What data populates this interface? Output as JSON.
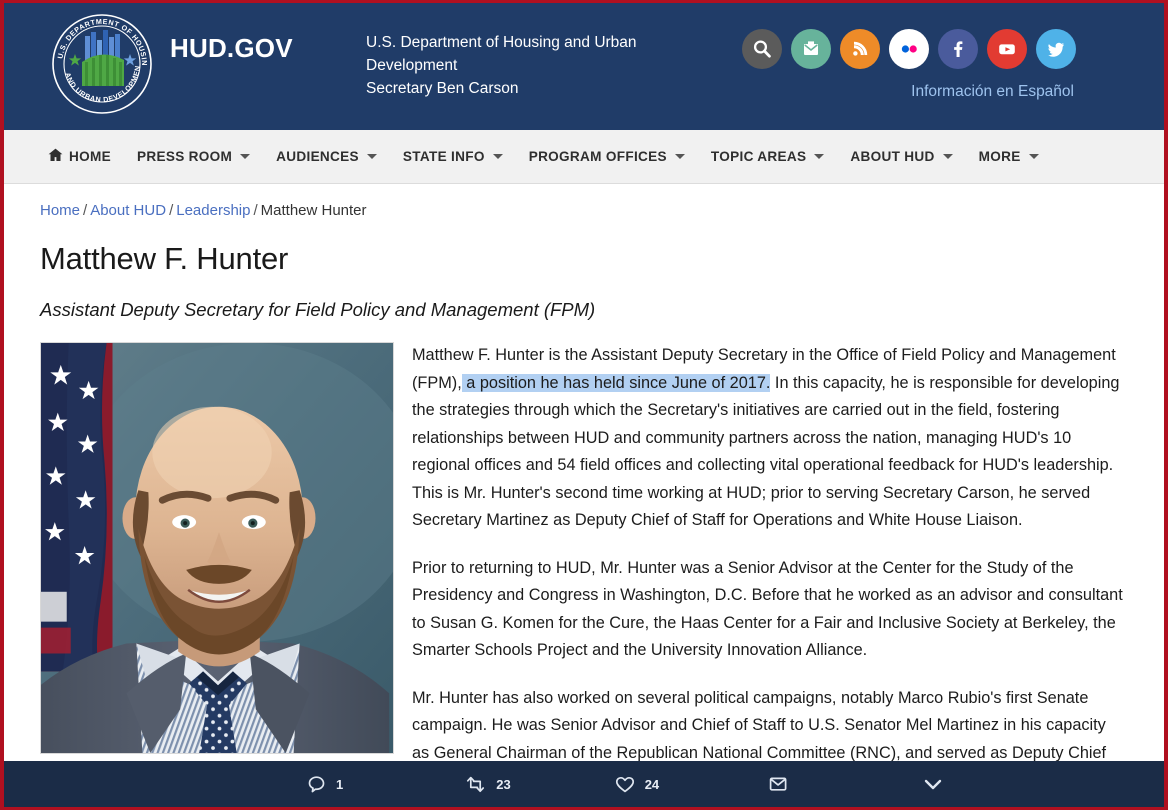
{
  "header": {
    "wordmark": "HUD.GOV",
    "seal_text": "U.S. DEPARTMENT OF HOUSING AND URBAN DEVELOPMENT",
    "department_line1": "U.S. Department of Housing and Urban Development",
    "department_line2": "Secretary Ben Carson",
    "espanol_label": "Información en Español",
    "background_color": "#203c68",
    "social": [
      {
        "name": "search-icon",
        "label": "Search",
        "color": "#5b5b5b"
      },
      {
        "name": "email-icon",
        "label": "Email",
        "color": "#67b39b"
      },
      {
        "name": "rss-icon",
        "label": "RSS",
        "color": "#ee8b28"
      },
      {
        "name": "flickr-icon",
        "label": "Flickr",
        "color": "#ffffff"
      },
      {
        "name": "facebook-icon",
        "label": "Facebook",
        "color": "#4a5b9c"
      },
      {
        "name": "youtube-icon",
        "label": "YouTube",
        "color": "#e23b32"
      },
      {
        "name": "twitter-icon",
        "label": "Twitter",
        "color": "#4fb2e8"
      }
    ]
  },
  "nav": {
    "items": [
      {
        "label": "HOME",
        "icon": "home-icon",
        "has_dropdown": false
      },
      {
        "label": "PRESS ROOM",
        "icon": "",
        "has_dropdown": true
      },
      {
        "label": "AUDIENCES",
        "icon": "",
        "has_dropdown": true
      },
      {
        "label": "STATE INFO",
        "icon": "",
        "has_dropdown": true
      },
      {
        "label": "PROGRAM OFFICES",
        "icon": "",
        "has_dropdown": true
      },
      {
        "label": "TOPIC AREAS",
        "icon": "",
        "has_dropdown": true
      },
      {
        "label": "ABOUT HUD",
        "icon": "",
        "has_dropdown": true
      },
      {
        "label": "MORE",
        "icon": "",
        "has_dropdown": true
      }
    ]
  },
  "breadcrumb": {
    "items": [
      {
        "label": "Home",
        "is_link": true
      },
      {
        "label": "About HUD",
        "is_link": true
      },
      {
        "label": "Leadership",
        "is_link": true
      },
      {
        "label": "Matthew Hunter",
        "is_link": false
      }
    ],
    "separator": "/"
  },
  "page": {
    "title": "Matthew F. Hunter",
    "subtitle": "Assistant Deputy Secretary for Field Policy and Management (FPM)",
    "portrait_alt": "Official portrait of Matthew F. Hunter in a gray suit and navy polka-dot tie in front of an American flag",
    "paragraphs": [
      {
        "before": "Matthew F. Hunter is the Assistant Deputy Secretary in the Office of Field Policy and Management (FPM),",
        "selected": " a position he has held since June of 2017.",
        "after": " In this capacity, he is responsible for developing the strategies through which the Secretary's initiatives are carried out in the field, fostering relationships between HUD and community partners across the nation, managing HUD's 10 regional offices and 54 field offices and collecting vital operational feedback for HUD's leadership. This is Mr. Hunter's second time working at HUD; prior to serving Secretary Carson, he served Secretary Martinez as Deputy Chief of Staff for Operations and White House Liaison."
      },
      {
        "text": "Prior to returning to HUD, Mr. Hunter was a Senior Advisor at the Center for the Study of the Presidency and Congress in Washington, D.C. Before that he worked as an advisor and consultant to Susan G. Komen for the Cure, the Haas Center for a Fair and Inclusive Society at Berkeley, the Smarter Schools Project and the University Innovation Alliance."
      },
      {
        "text": "Mr. Hunter has also worked on several political campaigns, notably Marco Rubio's first Senate campaign. He was Senior Advisor and Chief of Staff to U.S. Senator Mel Martinez in his capacity as General Chairman of the Republican National Committee (RNC), and served as Deputy Chief of Staff and State Director for Senator Martinez's official Senate office."
      }
    ],
    "selection_color": "#b2d0f2"
  },
  "action_bar": {
    "background_color": "#1b2c47",
    "actions": [
      {
        "name": "reply-action",
        "icon": "reply-icon",
        "count": "1"
      },
      {
        "name": "retweet-action",
        "icon": "retweet-icon",
        "count": "23"
      },
      {
        "name": "like-action",
        "icon": "heart-icon",
        "count": "24"
      },
      {
        "name": "share-action",
        "icon": "envelope-icon",
        "count": ""
      },
      {
        "name": "more-action",
        "icon": "chevron-down-icon",
        "count": ""
      }
    ]
  }
}
